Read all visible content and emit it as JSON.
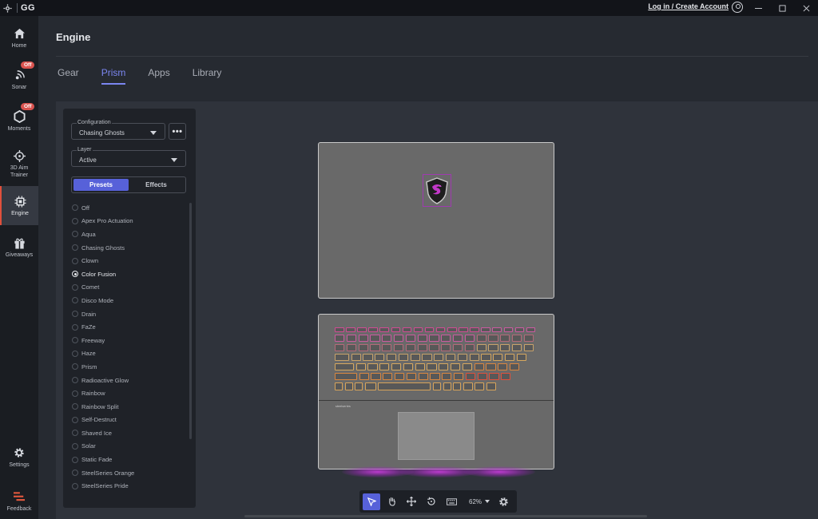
{
  "titlebar": {
    "app_name": "GG",
    "login_label": "Log in / Create Account"
  },
  "sidebar": {
    "items": [
      {
        "label": "Home",
        "icon": "home-icon"
      },
      {
        "label": "Sonar",
        "icon": "sonar-icon",
        "badge": "Off"
      },
      {
        "label": "Moments",
        "icon": "moments-icon",
        "badge": "Off"
      },
      {
        "label": "3D Aim Trainer",
        "icon": "crosshair-icon"
      },
      {
        "label": "Engine",
        "icon": "chip-icon",
        "active": true
      },
      {
        "label": "Giveaways",
        "icon": "gift-icon"
      },
      {
        "label": "Settings",
        "icon": "gear-icon"
      },
      {
        "label": "Feedback",
        "icon": "feedback-icon"
      }
    ]
  },
  "page": {
    "title": "Engine"
  },
  "tabs": [
    {
      "label": "Gear"
    },
    {
      "label": "Prism",
      "active": true
    },
    {
      "label": "Apps"
    },
    {
      "label": "Library"
    }
  ],
  "panel": {
    "configuration_label": "Configuration",
    "configuration_value": "Chasing Ghosts",
    "more_label": "•••",
    "layer_label": "Layer",
    "layer_value": "Active",
    "presets_tab": "Presets",
    "effects_tab": "Effects",
    "selected_preset": "Color Fusion",
    "presets": [
      "Off",
      "Apex Pro Actuation",
      "Aqua",
      "Chasing Ghosts",
      "Clown",
      "Color Fusion",
      "Comet",
      "Disco Mode",
      "Drain",
      "FaZe",
      "Freeway",
      "Haze",
      "Prism",
      "Radioactive Glow",
      "Rainbow",
      "Rainbow Split",
      "Self-Destruct",
      "Shaved Ice",
      "Solar",
      "Static Fade",
      "SteelSeries Orange",
      "SteelSeries Pride"
    ]
  },
  "device": {
    "brand_text": "steelseries"
  },
  "toolbar": {
    "zoom": "62%"
  },
  "colors": {
    "accent": "#5761d9",
    "tab_active": "#7b86f0",
    "badge": "#d9534f",
    "glow": "#d23ce6"
  }
}
